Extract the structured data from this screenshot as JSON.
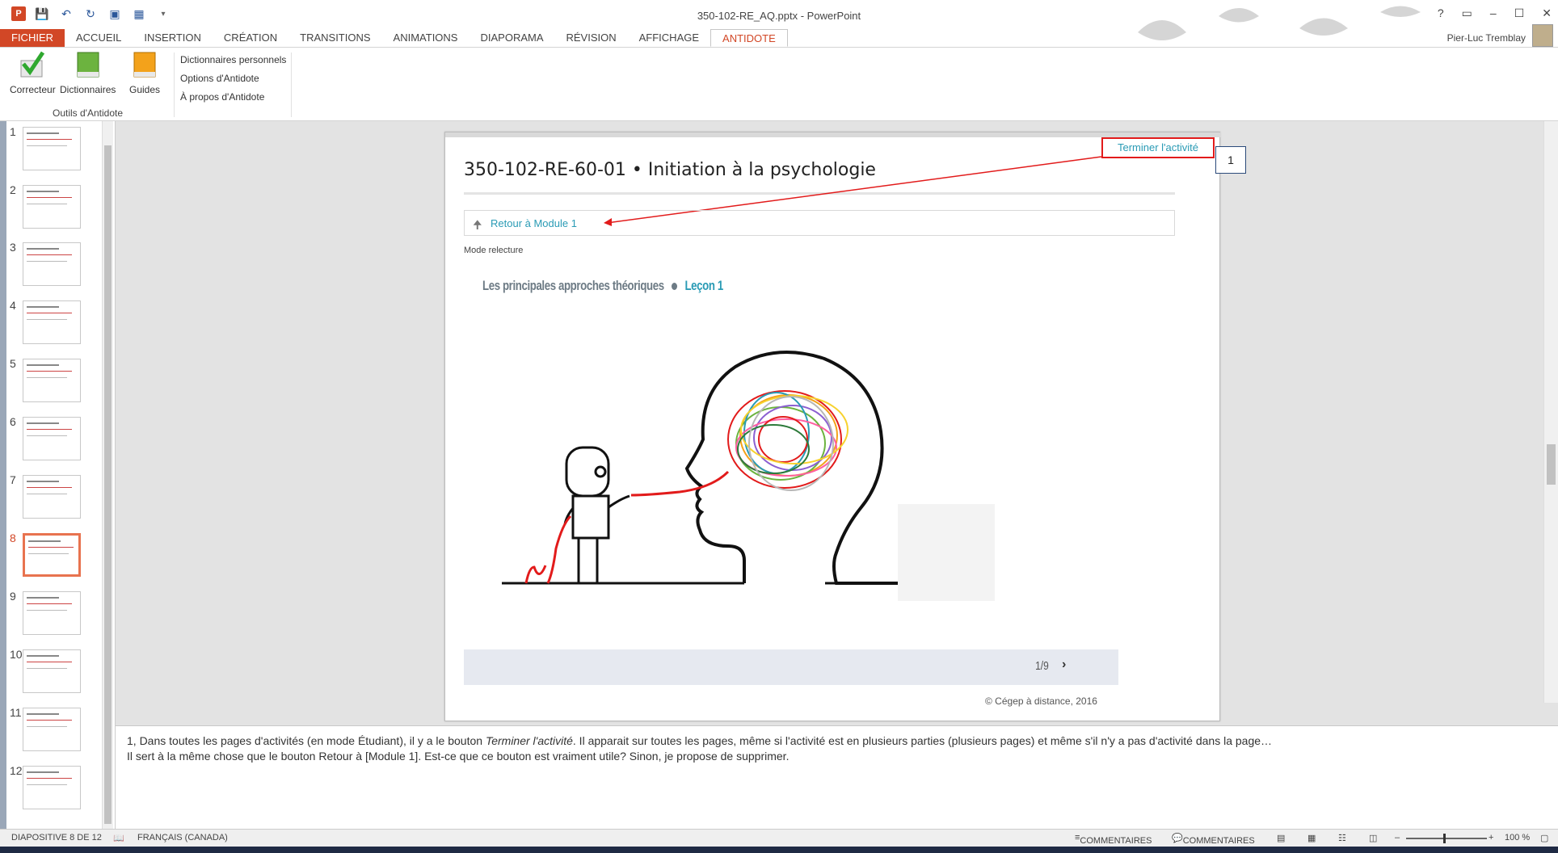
{
  "window": {
    "title": "350-102-RE_AQ.pptx - PowerPoint",
    "controls": [
      "?",
      "▭",
      "–",
      "☐",
      "✕"
    ]
  },
  "ribbon": {
    "tabs": [
      "FICHIER",
      "ACCUEIL",
      "INSERTION",
      "CRÉATION",
      "TRANSITIONS",
      "ANIMATIONS",
      "DIAPORAMA",
      "RÉVISION",
      "AFFICHAGE",
      "ANTIDOTE"
    ],
    "active_tab": "ANTIDOTE",
    "user": "Pier-Luc Tremblay",
    "buttons": {
      "correcteur": "Correcteur",
      "dictionnaires": "Dictionnaires",
      "guides": "Guides"
    },
    "links": [
      "Dictionnaires personnels",
      "Options d'Antidote",
      "À propos d'Antidote"
    ],
    "group_label": "Outils d'Antidote"
  },
  "thumbnails": {
    "numbers": [
      "1",
      "2",
      "3",
      "4",
      "5",
      "6",
      "7",
      "8",
      "9",
      "10",
      "11",
      "12"
    ],
    "selected": 8
  },
  "slide": {
    "course_title": "350-102-RE-60-01 • Initiation à la psychologie",
    "terminer_button": "Terminer l'activité",
    "callout_number": "1",
    "retour_link": "Retour à Module 1",
    "mode": "Mode relecture",
    "lesson_title": "Les principales approches théoriques",
    "lesson_number": "Leçon 1",
    "pager": "1/9",
    "copyright": "© Cégep à distance, 2016"
  },
  "notes": {
    "line1_prefix": "1, Dans toutes les pages d'activités (en mode Étudiant), il y a le bouton ",
    "line1_em": "Terminer l'activité",
    "line1_suffix": ". Il apparait sur toutes les pages, même si l'activité est en plusieurs parties (plusieurs pages) et même s'il n'y a pas d'activité dans la page…",
    "line2": "Il sert à la même chose que le bouton Retour à [Module 1]. Est-ce que ce bouton est vraiment utile? Sinon, je propose de supprimer."
  },
  "statusbar": {
    "slide_count": "DIAPOSITIVE 8 DE 12",
    "language": "FRANÇAIS (CANADA)",
    "notes_btn": "COMMENTAIRES",
    "comments_btn": "COMMENTAIRES",
    "zoom": "100 %"
  },
  "colors": {
    "accent": "#d24726",
    "link": "#2a9bb5",
    "callout_red": "#e21b1b"
  }
}
